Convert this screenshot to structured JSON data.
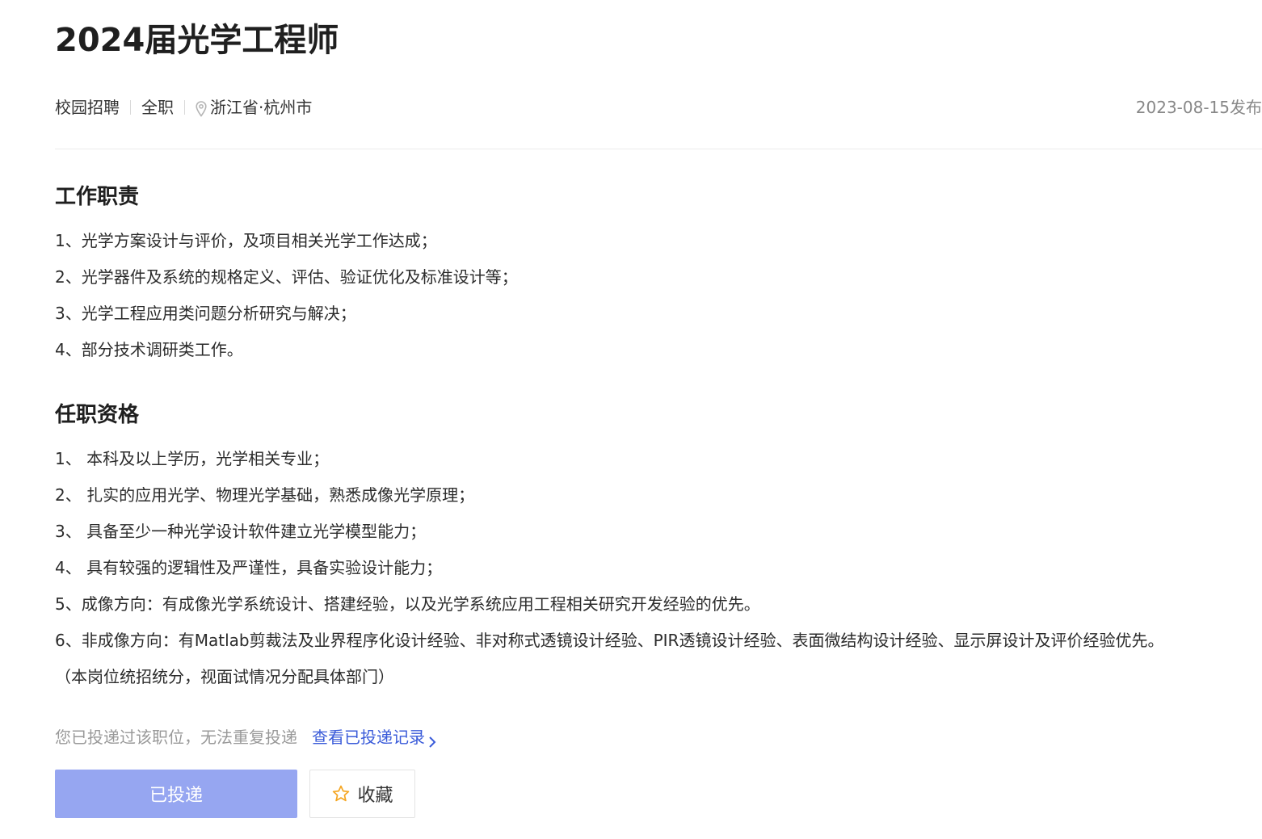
{
  "job": {
    "title": "2024届光学工程师",
    "recruit_type": "校园招聘",
    "employment_type": "全职",
    "location": "浙江省·杭州市",
    "publish_date": "2023-08-15发布"
  },
  "responsibilities": {
    "heading": "工作职责",
    "items": [
      "1、光学方案设计与评价，及项目相关光学工作达成；",
      "2、光学器件及系统的规格定义、评估、验证优化及标准设计等；",
      "3、光学工程应用类问题分析研究与解决；",
      "4、部分技术调研类工作。"
    ]
  },
  "qualifications": {
    "heading": "任职资格",
    "items": [
      "1、 本科及以上学历，光学相关专业；",
      "2、 扎实的应用光学、物理光学基础，熟悉成像光学原理；",
      "3、 具备至少一种光学设计软件建立光学模型能力；",
      "4、 具有较强的逻辑性及严谨性，具备实验设计能力；",
      "5、成像方向：有成像光学系统设计、搭建经验，以及光学系统应用工程相关研究开发经验的优先。",
      "6、非成像方向：有Matlab剪裁法及业界程序化设计经验、非对称式透镜设计经验、PIR透镜设计经验、表面微结构设计经验、显示屏设计及评价经验优先。",
      "（本岗位统招统分，视面试情况分配具体部门）"
    ]
  },
  "application": {
    "note": "您已投递过该职位，无法重复投递",
    "record_link": "查看已投递记录",
    "applied_label": "已投递",
    "favorite_label": "收藏"
  },
  "colors": {
    "accent": "#3a5bd9",
    "applied_button_bg": "#96a6f1",
    "star": "#f5a623"
  },
  "icons": {
    "location": "location-pin-icon",
    "link_arrow": "chevron-right-icon",
    "favorite": "star-outline-icon"
  }
}
